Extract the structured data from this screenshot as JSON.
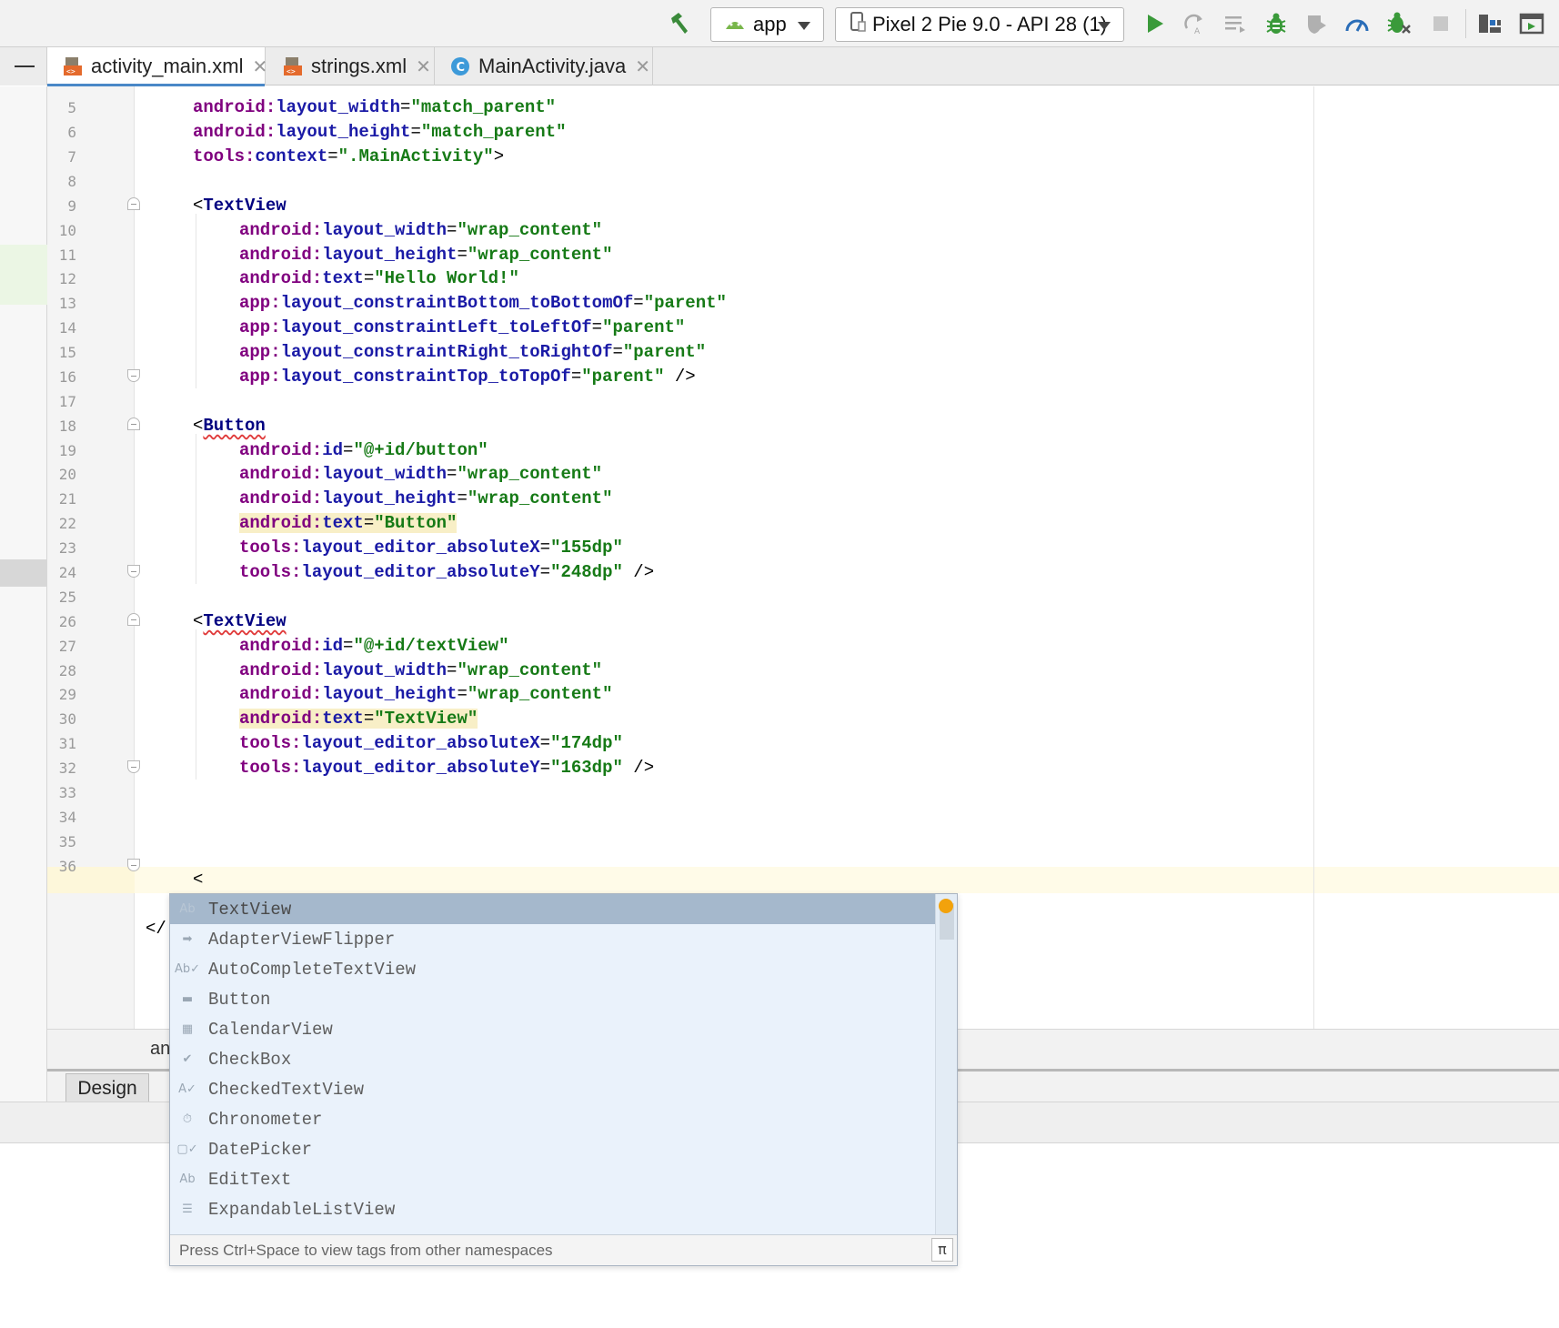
{
  "toolbar": {
    "run_config": "app",
    "device": "Pixel 2 Pie 9.0 - API 28 (1)",
    "icons": [
      "hammer-icon",
      "android-icon",
      "device-icon",
      "run-icon",
      "apply-changes-icon",
      "attach-icon",
      "debug-icon",
      "coverage-icon",
      "profile-icon",
      "debug-attach-icon",
      "stop-icon",
      "project-structure-icon",
      "avd-manager-icon"
    ],
    "colors": {
      "run": "#3a9a3a",
      "debug": "#3a9a3a",
      "profile": "#2a6db8",
      "hammer": "#3a8a3a"
    }
  },
  "tabs": [
    {
      "label": "activity_main.xml",
      "icon": "xml-layout-icon",
      "active": true
    },
    {
      "label": "strings.xml",
      "icon": "xml-values-icon",
      "active": false
    },
    {
      "label": "MainActivity.java",
      "icon": "java-class-icon",
      "active": false
    }
  ],
  "editor": {
    "line_numbers": [
      "5",
      "6",
      "7",
      "8",
      "9",
      "10",
      "11",
      "12",
      "13",
      "14",
      "15",
      "16",
      "17",
      "18",
      "19",
      "20",
      "21",
      "22",
      "23",
      "24",
      "25",
      "26",
      "27",
      "28",
      "29",
      "30",
      "31",
      "32",
      "33",
      "34",
      "35",
      "36"
    ],
    "lines": {
      "l5": {
        "ns": "android:",
        "attr": "layout_width",
        "eq": "=",
        "val": "\"match_parent\""
      },
      "l6": {
        "ns": "android:",
        "attr": "layout_height",
        "eq": "=",
        "val": "\"match_parent\""
      },
      "l7": {
        "ns": "tools:",
        "attr": "context",
        "eq": "=",
        "val": "\".MainActivity\"",
        "tail": ">"
      },
      "l9": {
        "lt": "<",
        "tag": "TextView"
      },
      "l10": {
        "ns": "android:",
        "attr": "layout_width",
        "eq": "=",
        "val": "\"wrap_content\""
      },
      "l11": {
        "ns": "android:",
        "attr": "layout_height",
        "eq": "=",
        "val": "\"wrap_content\""
      },
      "l12": {
        "ns": "android:",
        "attr": "text",
        "eq": "=",
        "val": "\"Hello World!\""
      },
      "l13": {
        "ns": "app:",
        "attr": "layout_constraintBottom_toBottomOf",
        "eq": "=",
        "val": "\"parent\""
      },
      "l14": {
        "ns": "app:",
        "attr": "layout_constraintLeft_toLeftOf",
        "eq": "=",
        "val": "\"parent\""
      },
      "l15": {
        "ns": "app:",
        "attr": "layout_constraintRight_toRightOf",
        "eq": "=",
        "val": "\"parent\""
      },
      "l16": {
        "ns": "app:",
        "attr": "layout_constraintTop_toTopOf",
        "eq": "=",
        "val": "\"parent\"",
        "tail": " />"
      },
      "l18": {
        "lt": "<",
        "tag": "Button"
      },
      "l19": {
        "ns": "android:",
        "attr": "id",
        "eq": "=",
        "val": "\"@+id/button\""
      },
      "l20": {
        "ns": "android:",
        "attr": "layout_width",
        "eq": "=",
        "val": "\"wrap_content\""
      },
      "l21": {
        "ns": "android:",
        "attr": "layout_height",
        "eq": "=",
        "val": "\"wrap_content\""
      },
      "l22": {
        "ns": "android:",
        "attr": "text",
        "eq": "=",
        "val": "\"Button\""
      },
      "l23": {
        "ns": "tools:",
        "attr": "layout_editor_absoluteX",
        "eq": "=",
        "val": "\"155dp\""
      },
      "l24": {
        "ns": "tools:",
        "attr": "layout_editor_absoluteY",
        "eq": "=",
        "val": "\"248dp\"",
        "tail": " />"
      },
      "l26": {
        "lt": "<",
        "tag": "TextView"
      },
      "l27": {
        "ns": "android:",
        "attr": "id",
        "eq": "=",
        "val": "\"@+id/textView\""
      },
      "l28": {
        "ns": "android:",
        "attr": "layout_width",
        "eq": "=",
        "val": "\"wrap_content\""
      },
      "l29": {
        "ns": "android:",
        "attr": "layout_height",
        "eq": "=",
        "val": "\"wrap_content\""
      },
      "l30": {
        "ns": "android:",
        "attr": "text",
        "eq": "=",
        "val": "\"TextView\""
      },
      "l31": {
        "ns": "tools:",
        "attr": "layout_editor_absoluteX",
        "eq": "=",
        "val": "\"174dp\""
      },
      "l32": {
        "ns": "tools:",
        "attr": "layout_editor_absoluteY",
        "eq": "=",
        "val": "\"163dp\"",
        "tail": " />"
      },
      "l34": {
        "text": "<"
      },
      "l36": {
        "text": "</"
      }
    }
  },
  "breadcrumb": {
    "text": "an"
  },
  "design_tab": {
    "label": "Design"
  },
  "completion": {
    "items": [
      {
        "label": "TextView",
        "icon": "text-view-icon",
        "icon_text": "Ab",
        "selected": true
      },
      {
        "label": "AdapterViewFlipper",
        "icon": "flipper-icon",
        "icon_text": "➡"
      },
      {
        "label": "AutoCompleteTextView",
        "icon": "autocomplete-icon",
        "icon_text": "Ab✓"
      },
      {
        "label": "Button",
        "icon": "button-icon",
        "icon_text": "▬"
      },
      {
        "label": "CalendarView",
        "icon": "calendar-icon",
        "icon_text": "▦"
      },
      {
        "label": "CheckBox",
        "icon": "checkbox-icon",
        "icon_text": "✔"
      },
      {
        "label": "CheckedTextView",
        "icon": "checked-text-icon",
        "icon_text": "A✓"
      },
      {
        "label": "Chronometer",
        "icon": "chronometer-icon",
        "icon_text": "⏱"
      },
      {
        "label": "DatePicker",
        "icon": "date-picker-icon",
        "icon_text": "▢✓"
      },
      {
        "label": "EditText",
        "icon": "edit-text-icon",
        "icon_text": "Ab"
      },
      {
        "label": "ExpandableListView",
        "icon": "list-icon",
        "icon_text": "☰"
      }
    ],
    "hint": "Press Ctrl+Space to view tags from other namespaces",
    "pi_symbol": "π"
  }
}
